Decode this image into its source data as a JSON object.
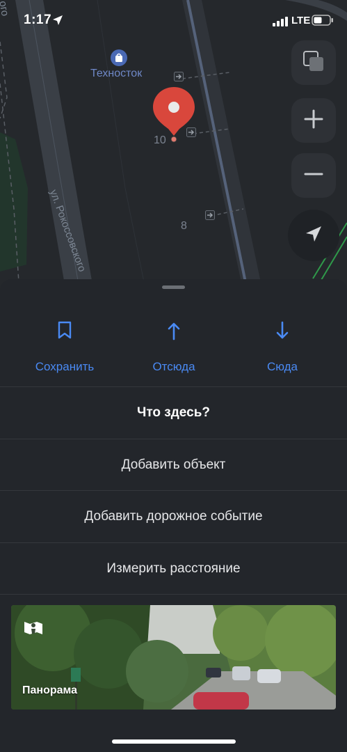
{
  "status_bar": {
    "time": "1:17",
    "network": "LTE"
  },
  "map": {
    "poi_name": "Техносток",
    "street_name": "ул. Рокоссовского",
    "street_name_top": "ого",
    "house_numbers": [
      "10",
      "8"
    ],
    "icons": {
      "layers": "layers-icon",
      "zoom_in": "plus-icon",
      "zoom_out": "minus-icon",
      "locate": "location-arrow-icon",
      "pin": "map-pin-icon",
      "poi": "shopping-bag-icon"
    }
  },
  "sheet": {
    "actions": [
      {
        "label": "Сохранить",
        "icon": "bookmark-icon"
      },
      {
        "label": "Отсюда",
        "icon": "arrow-up-icon"
      },
      {
        "label": "Сюда",
        "icon": "arrow-down-icon"
      }
    ],
    "menu": [
      {
        "label": "Что здесь?"
      },
      {
        "label": "Добавить объект"
      },
      {
        "label": "Добавить дорожное событие"
      },
      {
        "label": "Измерить расстояние"
      }
    ],
    "panorama_label": "Панорама"
  },
  "colors": {
    "accent": "#4a8af4",
    "pin": "#d9473c",
    "background": "#23262b"
  }
}
